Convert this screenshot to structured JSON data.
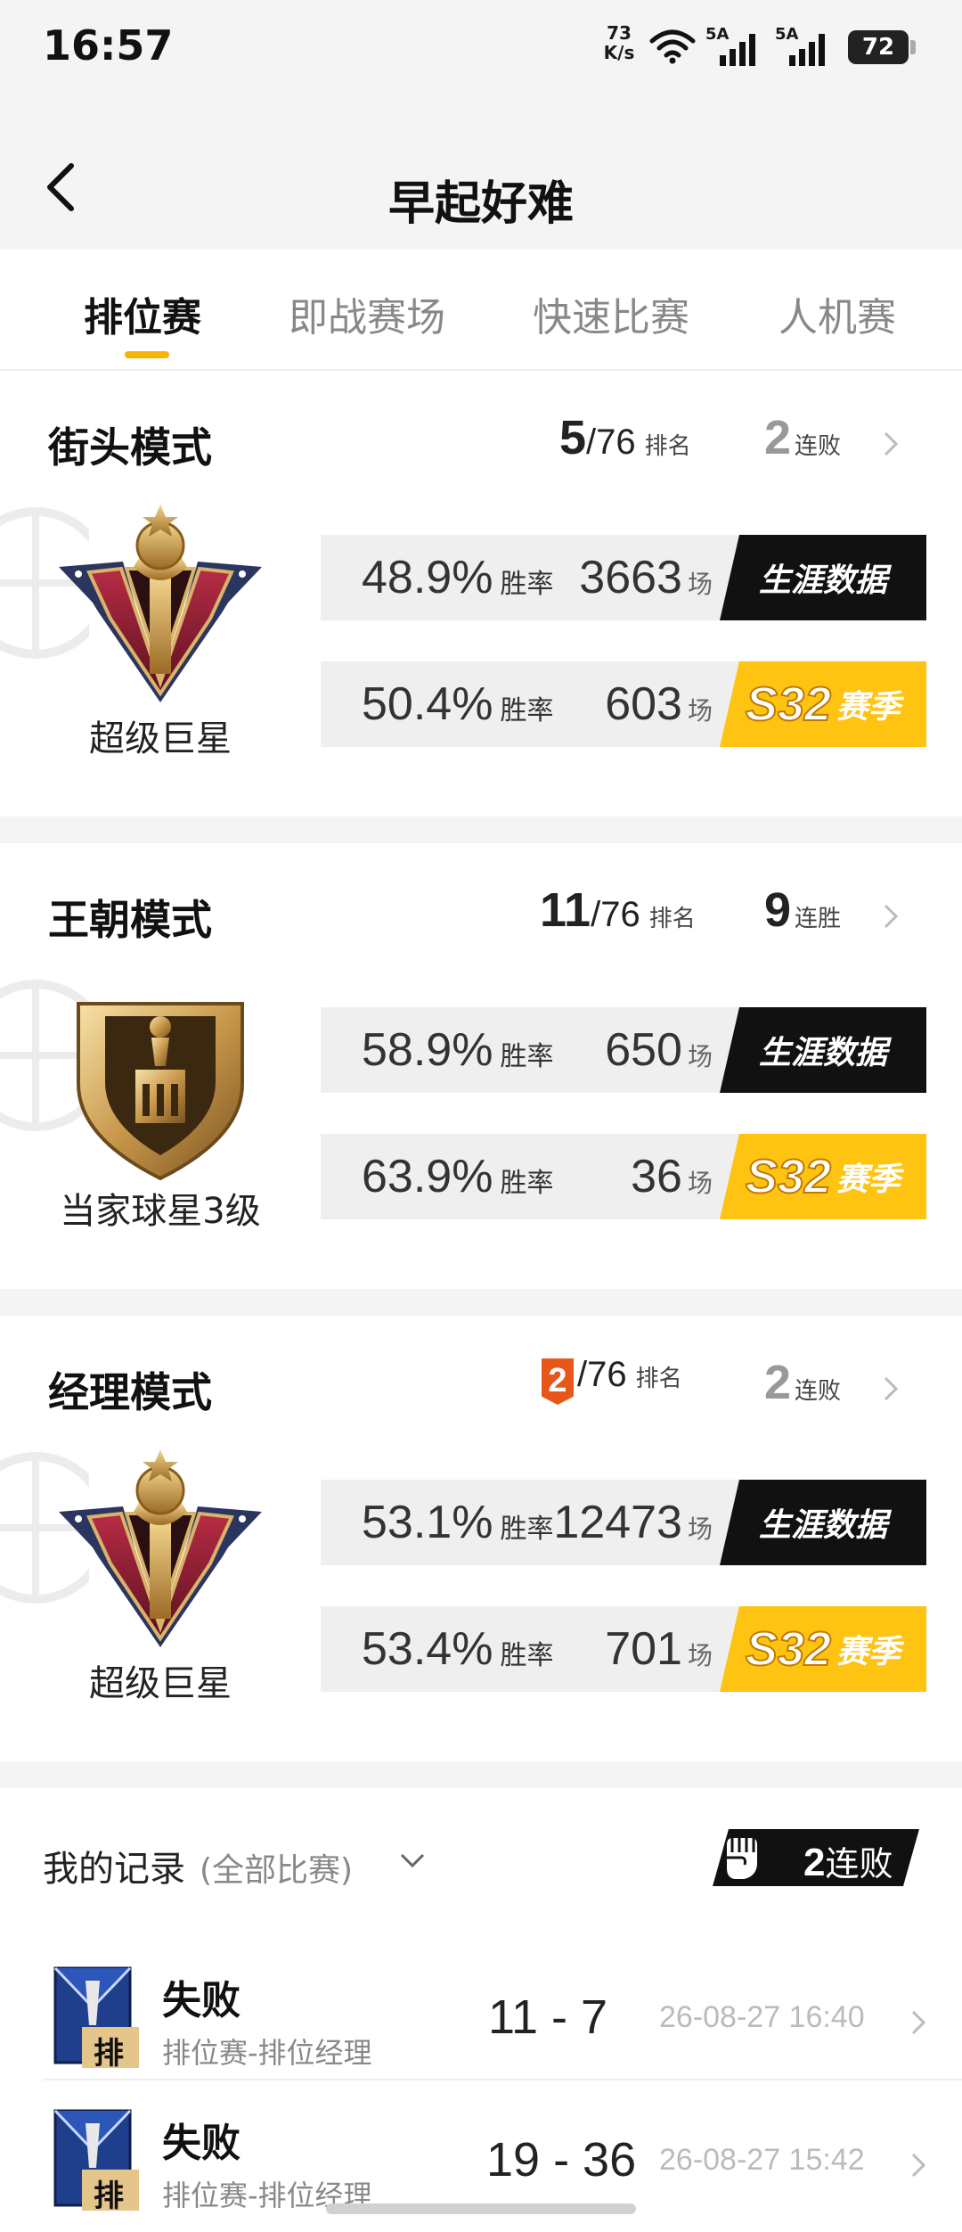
{
  "status_bar": {
    "time": "16:57",
    "net_speed_value": "73",
    "net_speed_unit": "K/s",
    "signal1_label": "5A",
    "signal2_label": "5A",
    "battery": "72"
  },
  "header": {
    "title": "早起好难"
  },
  "tabs": [
    {
      "label": "排位赛",
      "active": true
    },
    {
      "label": "即战赛场",
      "active": false
    },
    {
      "label": "快速比赛",
      "active": false
    },
    {
      "label": "人机赛",
      "active": false
    }
  ],
  "modes": [
    {
      "title": "街头模式",
      "rank": "5",
      "rank_total": "/76",
      "rank_label": "排名",
      "streak": "2",
      "streak_label": "连败",
      "tier": "超级巨星",
      "career": {
        "win_rate": "48.9%",
        "win_rate_label": "胜率",
        "games": "3663",
        "games_label": "场",
        "tag": "生涯数据"
      },
      "season": {
        "win_rate": "50.4%",
        "win_rate_label": "胜率",
        "games": "603",
        "games_label": "场",
        "tag_s": "S32",
        "tag": "赛季"
      }
    },
    {
      "title": "王朝模式",
      "rank": "11",
      "rank_total": "/76",
      "rank_label": "排名",
      "streak": "9",
      "streak_label": "连胜",
      "tier": "当家球星3级",
      "career": {
        "win_rate": "58.9%",
        "win_rate_label": "胜率",
        "games": "650",
        "games_label": "场",
        "tag": "生涯数据"
      },
      "season": {
        "win_rate": "63.9%",
        "win_rate_label": "胜率",
        "games": "36",
        "games_label": "场",
        "tag_s": "S32",
        "tag": "赛季"
      }
    },
    {
      "title": "经理模式",
      "rank": "2",
      "rank_total": "/76",
      "rank_label": "排名",
      "streak": "2",
      "streak_label": "连败",
      "tier": "超级巨星",
      "career": {
        "win_rate": "53.1%",
        "win_rate_label": "胜率",
        "games": "12473",
        "games_label": "场",
        "tag": "生涯数据"
      },
      "season": {
        "win_rate": "53.4%",
        "win_rate_label": "胜率",
        "games": "701",
        "games_label": "场",
        "tag_s": "S32",
        "tag": "赛季"
      }
    }
  ],
  "records": {
    "title": "我的记录",
    "filter": "(全部比赛)",
    "streak_num": "2",
    "streak_label": "连败",
    "items": [
      {
        "result": "失败",
        "mode": "排位赛-排位经理",
        "score": "11 - 7",
        "time": "26-08-27 16:40",
        "badge": "排"
      },
      {
        "result": "失败",
        "mode": "排位赛-排位经理",
        "score": "19 - 36",
        "time": "26-08-27 15:42",
        "badge": "排"
      }
    ]
  },
  "colors": {
    "accent": "#f7b500",
    "season_tag": "#ffc312",
    "career_tag": "#111111",
    "rank_badge": "#e8571a"
  }
}
